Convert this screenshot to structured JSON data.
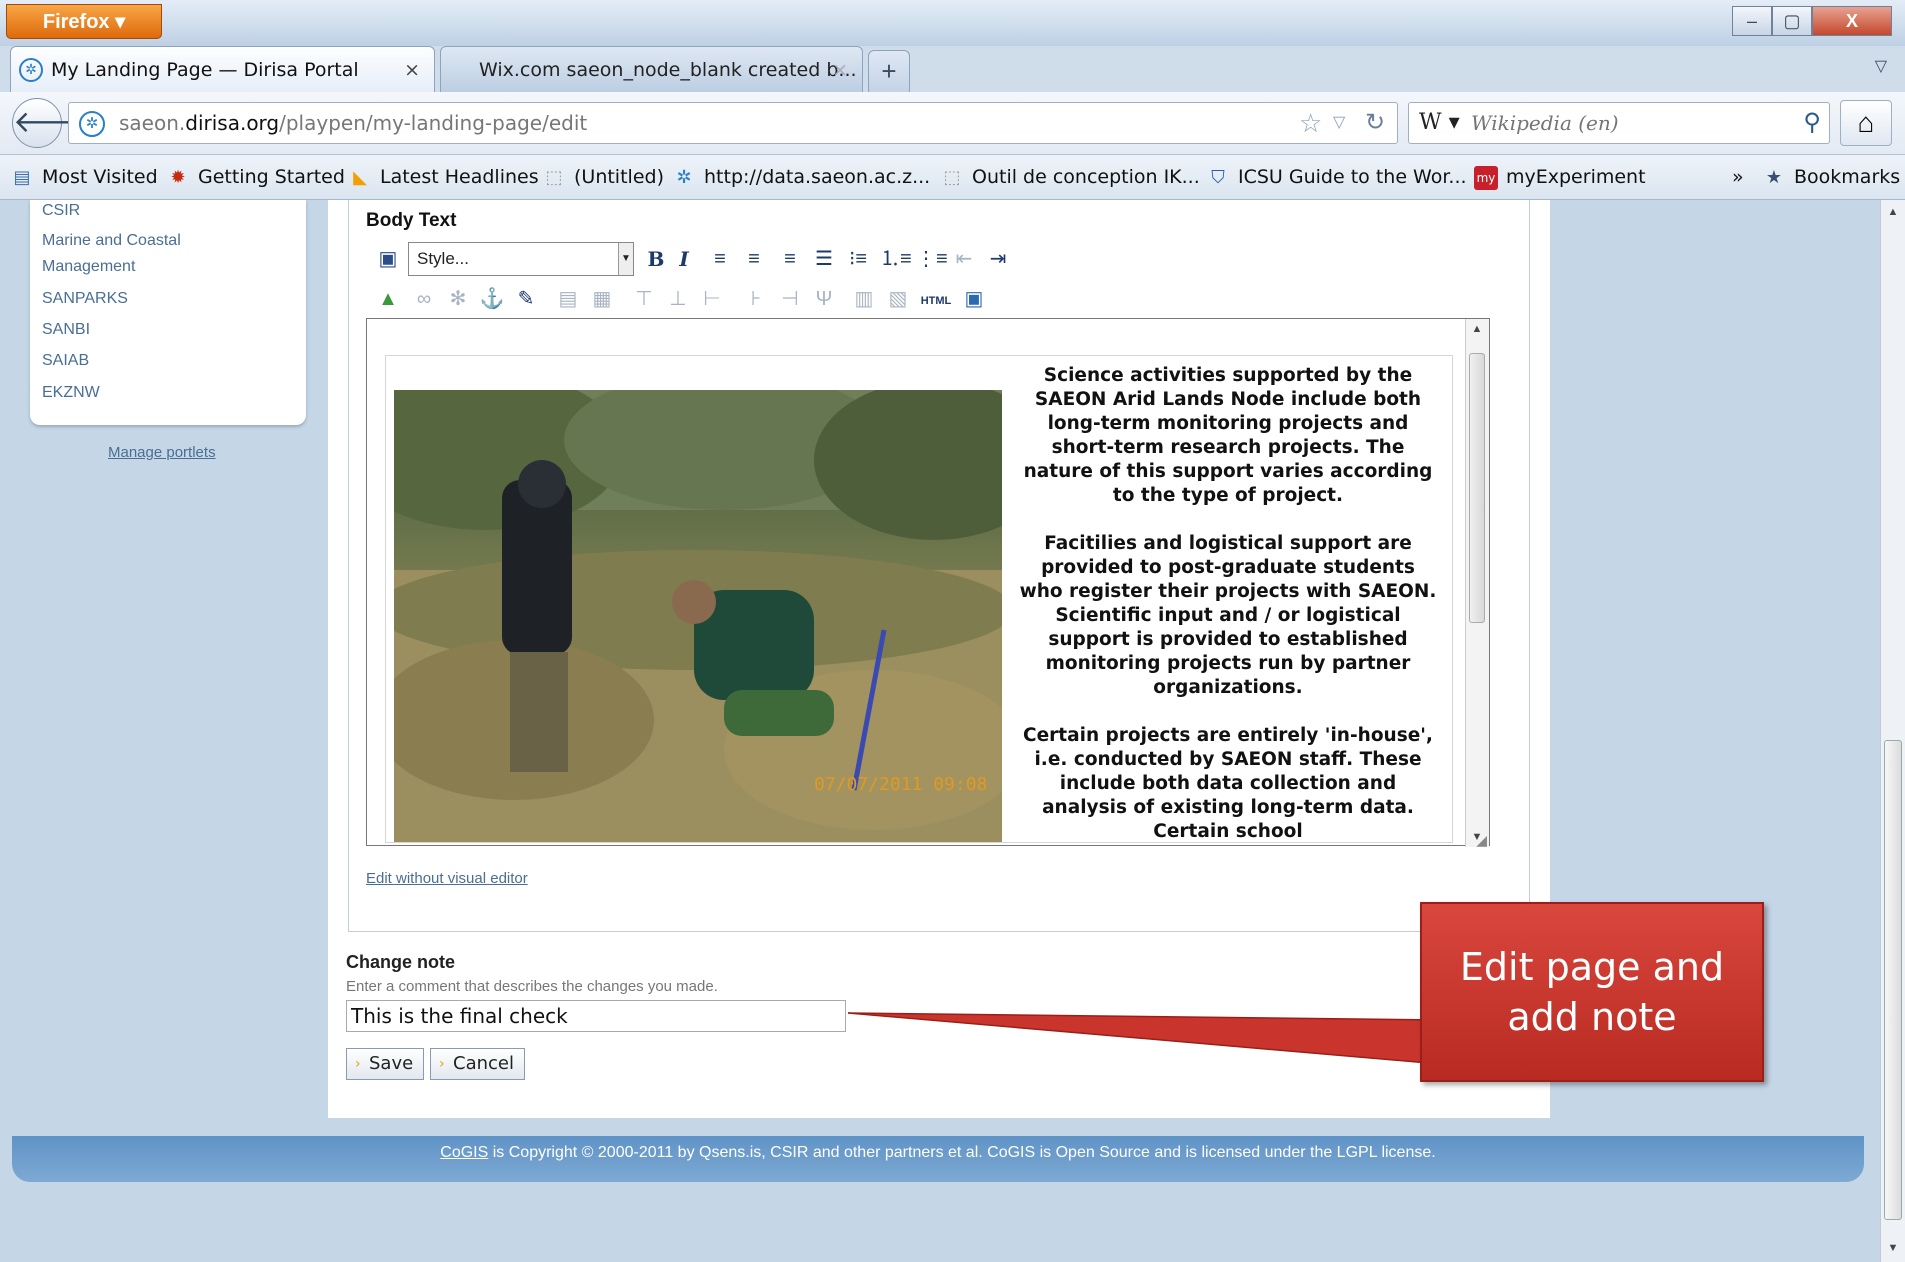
{
  "window": {
    "app_menu": "Firefox ▾",
    "minimize": "–",
    "maximize": "▢",
    "close": "X"
  },
  "tabs": [
    {
      "label": "My Landing Page — Dirisa Portal",
      "close": "×"
    },
    {
      "label": "Wix.com saeon_node_blank created b...",
      "close": "×"
    }
  ],
  "new_tab": "+",
  "tab_list": "▽",
  "nav": {
    "url_plain_1": "saeon.",
    "url_domain": "dirisa.org",
    "url_plain_2": "/playpen/my-landing-page/edit",
    "search_engine": "W ▾",
    "search_placeholder": "Wikipedia (en)"
  },
  "bookmarks": [
    "Most Visited",
    "Getting Started",
    "Latest Headlines",
    "(Untitled)",
    "http://data.saeon.ac.z...",
    "Outil de conception IK...",
    "ICSU Guide to the Wor...",
    "myExperiment"
  ],
  "bookmarks_overflow": "»",
  "bookmarks_menu": "Bookmarks",
  "sidebar": {
    "links": [
      "CSIR",
      "Marine and Coastal",
      "Management",
      "SANPARKS",
      "SANBI",
      "SAIAB",
      "EKZNW"
    ],
    "manage": "Manage portlets"
  },
  "editor": {
    "label": "Body Text",
    "style_select": "Style...",
    "html_button": "HTML",
    "paragraphs": [
      "Science activities supported by the SAEON Arid Lands Node include both long-term monitoring projects and short-term research projects. The nature of this support varies according to the type of project.",
      "Facitilies and logistical support are provided to post-graduate students who register their projects with SAEON. Scientific input and / or logistical support is provided to established monitoring projects run by partner organizations.",
      "Certain projects are entirely 'in-house', i.e. conducted by SAEON staff. These include both data collection and analysis of existing long-term data. Certain school"
    ],
    "photo_timestamp": "07/07/2011 09:08",
    "edit_without": "Edit without visual editor"
  },
  "change_note": {
    "label": "Change note",
    "help": "Enter a comment that describes the changes you made.",
    "value": "This is the final check"
  },
  "buttons": {
    "save": "Save",
    "cancel": "Cancel"
  },
  "footer": {
    "link": "CoGIS",
    "text": " is Copyright © 2000-2011 by Qsens.is, CSIR and other partners et al. CoGIS is Open Source and is licensed under the LGPL license."
  },
  "callout": {
    "line1": "Edit page and",
    "line2": "add note"
  },
  "colors": {
    "callout": "#c9352c",
    "firefox_button": "#e8760f",
    "link": "#4a6e94",
    "footer": "#6d9ccb"
  }
}
